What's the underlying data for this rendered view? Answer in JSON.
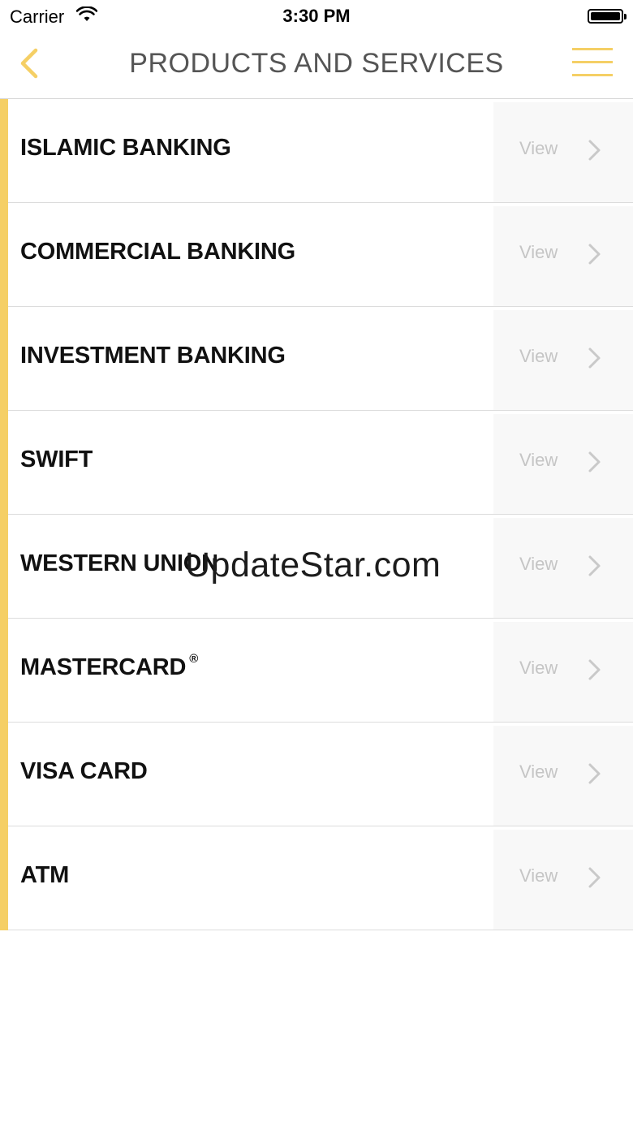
{
  "status_bar": {
    "carrier": "Carrier",
    "time": "3:30 PM"
  },
  "nav": {
    "title": "PRODUCTS AND SERVICES",
    "back_icon": "chevron-left-icon",
    "menu_icon": "hamburger-menu-icon"
  },
  "colors": {
    "accent": "#f5cf65",
    "view_text": "#c5c5c5",
    "view_panel": "#f8f8f8"
  },
  "items": [
    {
      "label": "ISLAMIC BANKING",
      "action": "View"
    },
    {
      "label": "COMMERCIAL BANKING",
      "action": "View"
    },
    {
      "label": "INVESTMENT BANKING",
      "action": "View"
    },
    {
      "label": "SWIFT",
      "action": "View"
    },
    {
      "label": "WESTERN UNION",
      "action": "View"
    },
    {
      "label": "MASTERCARD",
      "suffix": "®",
      "action": "View"
    },
    {
      "label": "VISA CARD",
      "action": "View"
    },
    {
      "label": "ATM",
      "action": "View"
    }
  ],
  "watermark": "UpdateStar.com"
}
